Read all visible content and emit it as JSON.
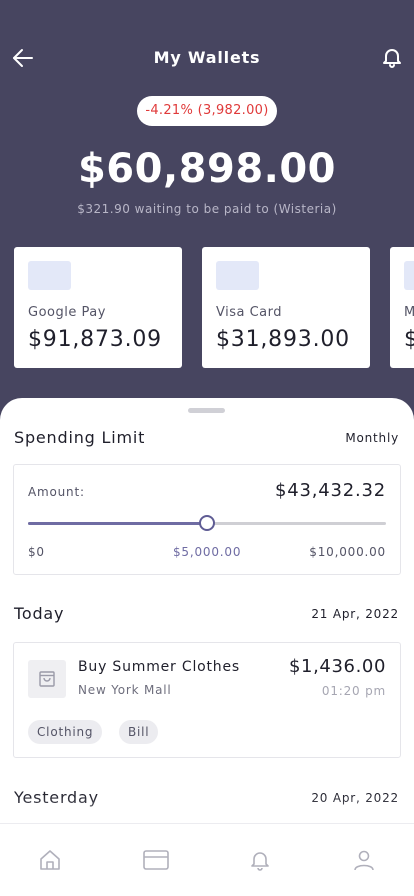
{
  "header": {
    "title": "My Wallets",
    "change": "-4.21% (3,982.00)",
    "balance": "$60,898.00",
    "pending_note": "$321.90 waiting to be paid to (Wisteria)",
    "back_icon": "arrow-left-icon",
    "bell_icon": "bell-icon"
  },
  "cards": [
    {
      "name": "Google Pay",
      "amount": "$91,873.09"
    },
    {
      "name": "Visa Card",
      "amount": "$31,893.00"
    },
    {
      "name": "M",
      "amount": "$"
    }
  ],
  "spending": {
    "title": "Spending Limit",
    "period": "Monthly",
    "amount_label": "Amount:",
    "amount": "$43,432.32",
    "slider_min": "$0",
    "slider_value": "$5,000.00",
    "slider_max": "$10,000.00",
    "slider_fraction": 0.5
  },
  "today": {
    "label": "Today",
    "date": "21 Apr, 2022",
    "transaction": {
      "title": "Buy Summer Clothes",
      "location": "New York Mall",
      "amount": "$1,436.00",
      "time": "01:20 pm",
      "icon": "shopping-bag-icon",
      "tags": [
        "Clothing",
        "Bill"
      ]
    }
  },
  "yesterday": {
    "label": "Yesterday",
    "date": "20 Apr, 2022"
  },
  "nav": {
    "items": [
      "home-icon",
      "card-icon",
      "bell-icon",
      "profile-icon"
    ]
  },
  "colors": {
    "header_bg": "#474560",
    "accent": "#6f6ca3",
    "negative": "#e03a3a"
  }
}
